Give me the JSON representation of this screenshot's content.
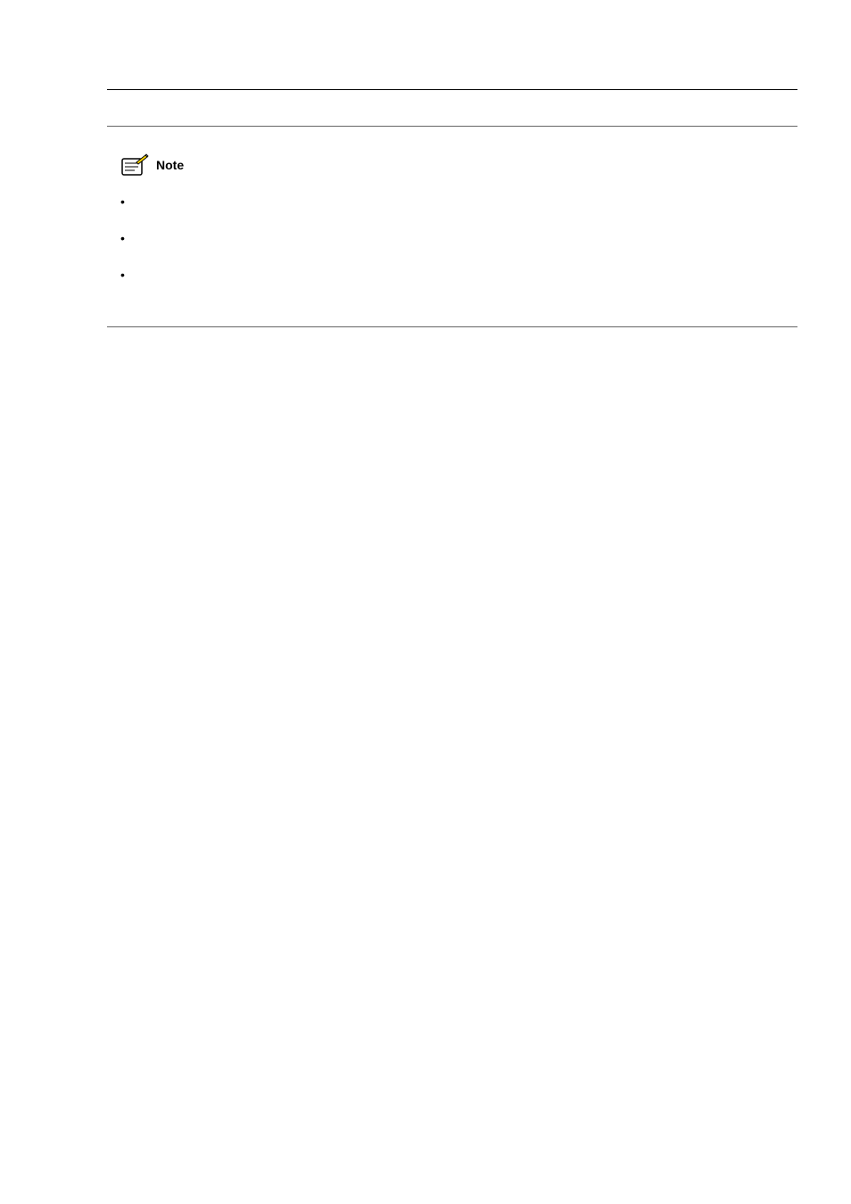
{
  "note": {
    "label": "Note",
    "bullets": [
      "",
      "",
      ""
    ]
  }
}
